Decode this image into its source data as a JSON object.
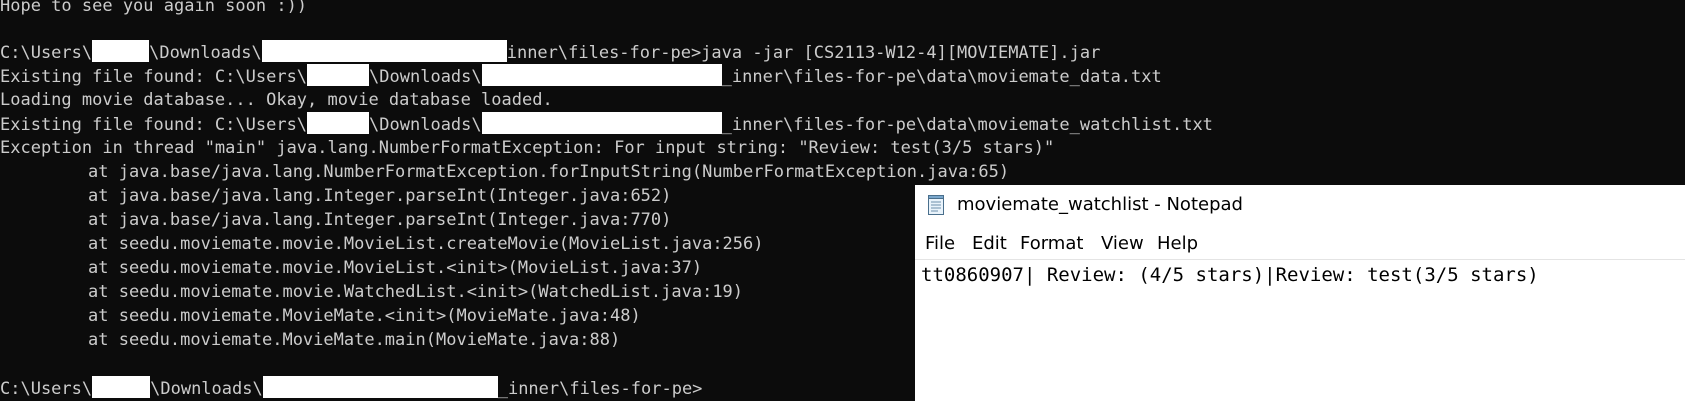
{
  "terminal": {
    "lines": [
      "Hope to see you again soon :))",
      "",
      "C:\\Users\\",
      "\\Downloads\\",
      "inner\\files-for-pe>java -jar [CS2113-W12-4][MOVIEMATE].jar",
      "Existing file found: C:\\Users\\",
      "\\Downloads\\",
      "_inner\\files-for-pe\\data\\moviemate_data.txt",
      "Loading movie database... Okay, movie database loaded.",
      "Existing file found: C:\\Users\\",
      "\\Downloads\\",
      "_inner\\files-for-pe\\data\\moviemate_watchlist.txt",
      "Exception in thread \"main\" java.lang.NumberFormatException: For input string: \"Review: test(3/5 stars)\"",
      "at java.base/java.lang.NumberFormatException.forInputString(NumberFormatException.java:65)",
      "at java.base/java.lang.Integer.parseInt(Integer.java:652)",
      "at java.base/java.lang.Integer.parseInt(Integer.java:770)",
      "at seedu.moviemate.movie.MovieList.createMovie(MovieList.java:256)",
      "at seedu.moviemate.movie.MovieList.<init>(MovieList.java:37)",
      "at seedu.moviemate.movie.WatchedList.<init>(WatchedList.java:19)",
      "at seedu.moviemate.MovieMate.<init>(MovieMate.java:48)",
      "at seedu.moviemate.MovieMate.main(MovieMate.java:88)",
      "",
      "C:\\Users\\",
      "\\Downloads\\",
      "_inner\\files-for-pe>"
    ]
  },
  "notepad": {
    "title": "moviemate_watchlist - Notepad",
    "app_icon": "notepad-icon",
    "menu": [
      "File",
      "Edit",
      "Format",
      "View",
      "Help"
    ],
    "content": "tt0860907| Review: (4/5 stars)|Review: test(3/5 stars)"
  },
  "colors": {
    "terminal_bg": "#0c0c0c",
    "terminal_fg": "#cccccc",
    "redaction": "#ffffff",
    "notepad_bg": "#ffffff"
  }
}
